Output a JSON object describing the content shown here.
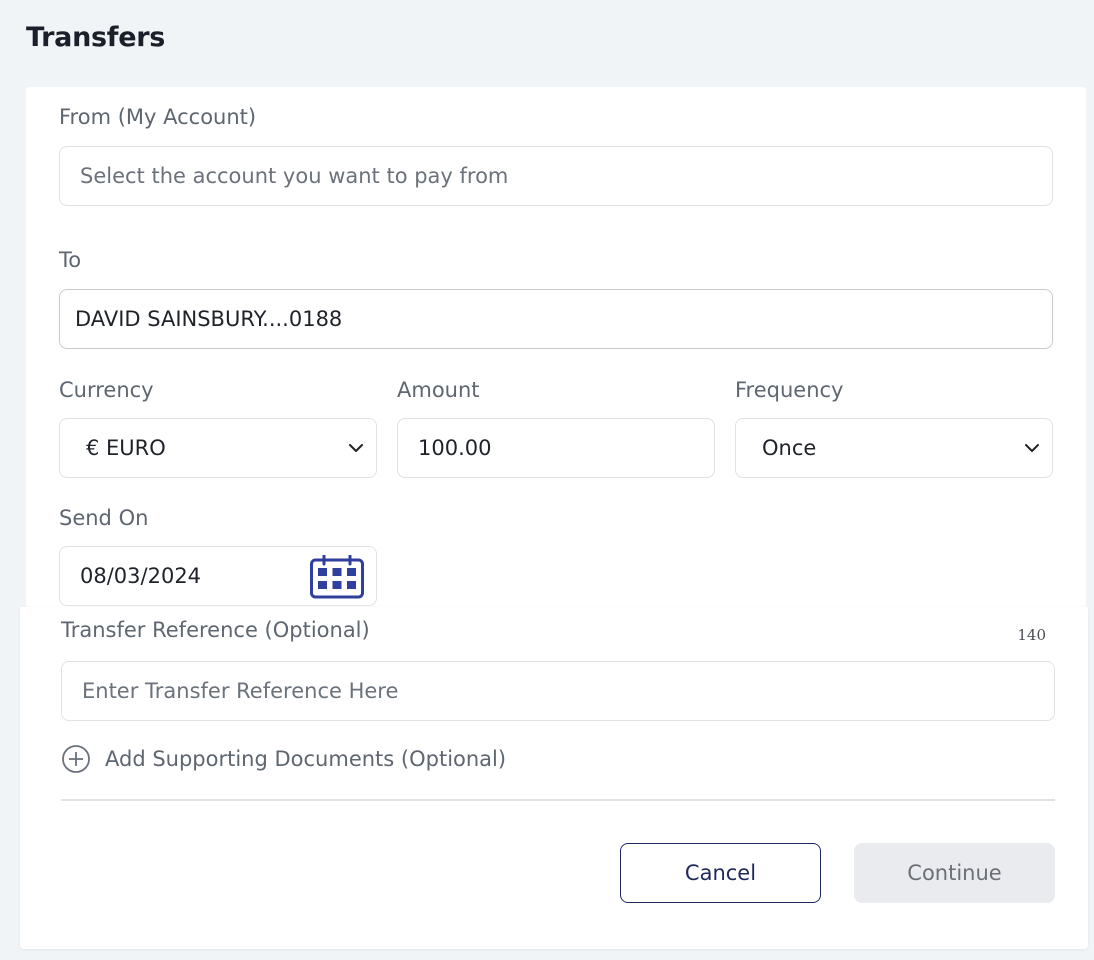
{
  "page": {
    "title": "Transfers"
  },
  "form": {
    "from": {
      "label": "From (My Account)",
      "placeholder": "Select the account you want to pay from"
    },
    "to": {
      "label": "To",
      "value": "DAVID SAINSBURY....0188"
    },
    "currency": {
      "label": "Currency",
      "value": "€ EURO"
    },
    "amount": {
      "label": "Amount",
      "value": "100.00"
    },
    "frequency": {
      "label": "Frequency",
      "value": "Once"
    },
    "send_on": {
      "label": "Send On",
      "value": "08/03/2024"
    },
    "reference": {
      "label": "Transfer Reference (Optional)",
      "char_count": "140",
      "placeholder": "Enter Transfer Reference Here"
    },
    "supporting_docs": {
      "label": "Add Supporting Documents (Optional)"
    }
  },
  "actions": {
    "cancel_label": "Cancel",
    "continue_label": "Continue"
  },
  "colors": {
    "accent": "#1f2a5c",
    "calendar_icon": "#2e3f9e",
    "background": "#f1f4f7"
  },
  "icons": {
    "select": "chevron-down-icon",
    "date": "calendar-icon",
    "add": "plus-circle-icon"
  }
}
